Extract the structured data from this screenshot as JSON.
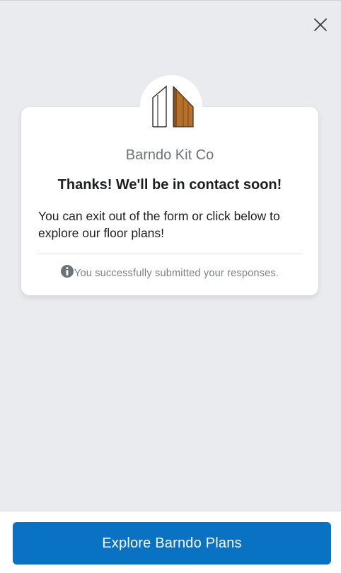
{
  "header": {
    "close_icon": "close-icon"
  },
  "card": {
    "logo_icon": "barndo-logo",
    "company_name": "Barndo Kit Co",
    "heading": "Thanks! We'll be in contact soon!",
    "body": "You can exit out of the form or click below to explore our floor plans!",
    "footnote_icon": "info-icon",
    "footnote": "You successfully submitted your responses."
  },
  "footer": {
    "cta_label": "Explore Barndo Plans"
  },
  "colors": {
    "background": "#e9ebef",
    "accent": "#0a72c2",
    "logo_wood": "#b5702c"
  }
}
